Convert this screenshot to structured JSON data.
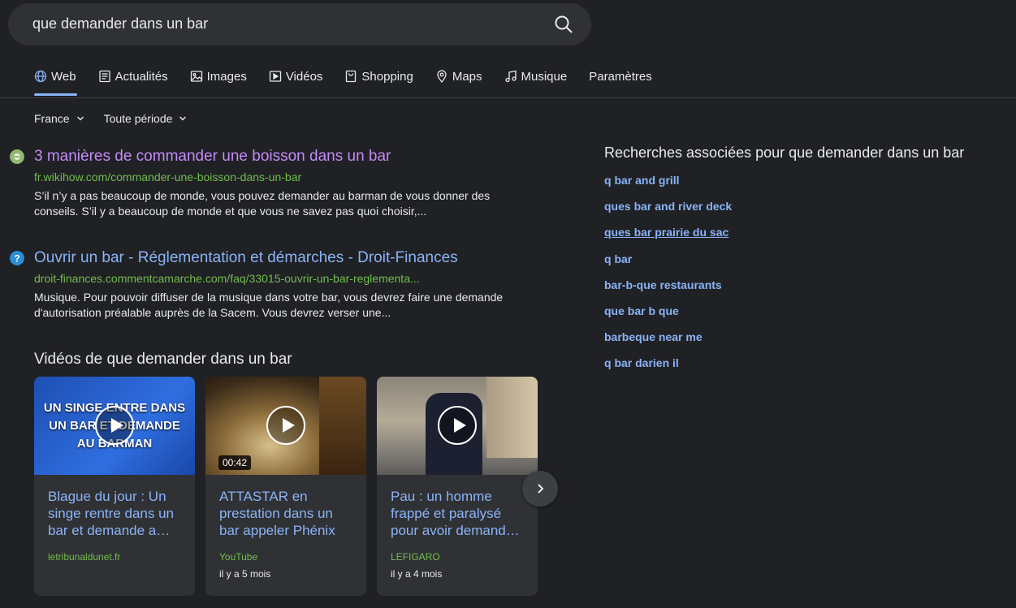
{
  "search": {
    "query": "que demander dans un bar"
  },
  "tabs": [
    {
      "label": "Web",
      "icon": "globe-icon"
    },
    {
      "label": "Actualités",
      "icon": "news-icon"
    },
    {
      "label": "Images",
      "icon": "image-icon"
    },
    {
      "label": "Vidéos",
      "icon": "video-icon"
    },
    {
      "label": "Shopping",
      "icon": "shopping-icon"
    },
    {
      "label": "Maps",
      "icon": "map-pin-icon"
    },
    {
      "label": "Musique",
      "icon": "music-icon"
    },
    {
      "label": "Paramètres",
      "icon": ""
    }
  ],
  "filters": {
    "region": "France",
    "period": "Toute période"
  },
  "results": [
    {
      "title": "3 manières de commander une boisson dans un bar",
      "url": "fr.wikihow.com/commander-une-boisson-dans-un-bar",
      "snippet": "S’il n’y a pas beaucoup de monde, vous pouvez demander au barman de vous donner des conseils. S’il y a beaucoup de monde et que vous ne savez pas quoi choisir,...",
      "title_color": "#c58af9"
    },
    {
      "title": "Ouvrir un bar - Réglementation et démarches - Droit-Finances",
      "url": "droit-finances.commentcamarche.com/faq/33015-ouvrir-un-bar-reglementa...",
      "snippet": "Musique. Pour pouvoir diffuser de la musique dans votre bar, vous devrez faire une demande d'autorisation préalable auprès de la Sacem. Vous devrez verser une...",
      "title_color": "#8ab4f8"
    }
  ],
  "videos": {
    "heading": "Vidéos de que demander dans un bar",
    "items": [
      {
        "thumb_text": "UN SINGE ENTRE DANS UN BAR ET DEMANDE AU BARMAN",
        "title": "Blague du jour : Un singe rentre dans un bar et demande a…",
        "source": "letribunaldunet.fr",
        "age": "",
        "duration": ""
      },
      {
        "thumb_text": "",
        "title": "ATTASTAR en prestation dans un bar appeler Phénix",
        "source": "YouTube",
        "age": "il y a 5 mois",
        "duration": "00:42"
      },
      {
        "thumb_text": "",
        "title": "Pau : un homme frappé et paralysé pour avoir demand…",
        "source": "LEFIGARO",
        "age": "il y a 4 mois",
        "duration": ""
      }
    ]
  },
  "related": {
    "heading": "Recherches associées pour que demander dans un bar",
    "items": [
      "q bar and grill",
      "ques bar and river deck",
      "ques bar prairie du sac",
      "q bar",
      "bar-b-que restaurants",
      "que bar b que",
      "barbeque near me",
      "q bar darien il"
    ]
  },
  "colors": {
    "background": "#202124",
    "link": "#8ab4f8",
    "visited_link": "#c58af9",
    "url_green": "#71bd4e"
  }
}
